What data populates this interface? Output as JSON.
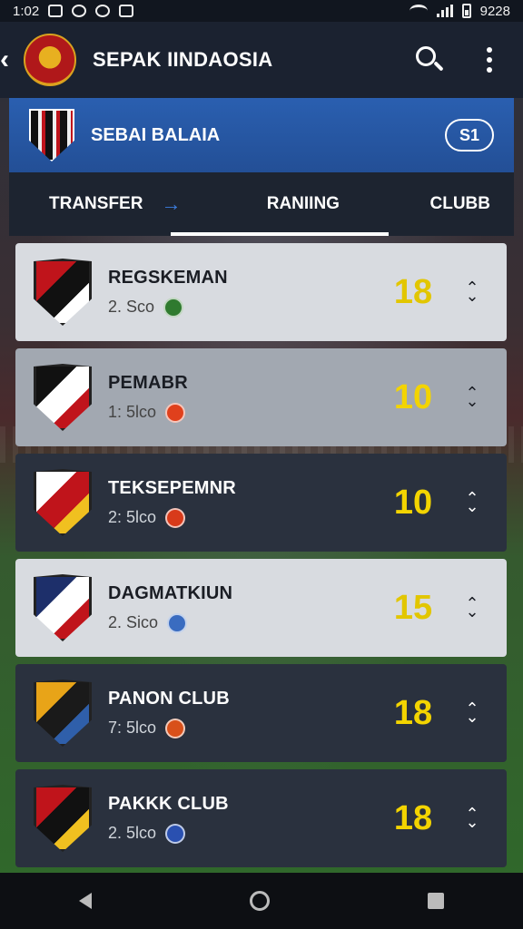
{
  "status": {
    "time": "1:02",
    "clock_right": "9228"
  },
  "app": {
    "title": "SEPAK IINDAOSIA"
  },
  "club": {
    "name": "SEBAI BALAIA",
    "badge": "S1"
  },
  "tabs": [
    {
      "label": "TRANSFER",
      "arrow": "→"
    },
    {
      "label": "RANIING"
    },
    {
      "label": "CLUBB"
    }
  ],
  "rows": [
    {
      "name": "REGSKEMAN",
      "sub": "2. Sco",
      "score": "18",
      "style": "light",
      "logo_colors": [
        "#c0141b",
        "#111111",
        "#ffffff"
      ],
      "mini_color": "#2f7a2f"
    },
    {
      "name": "PEMABR",
      "sub": "1: 5lco",
      "score": "10",
      "style": "mid",
      "logo_colors": [
        "#111111",
        "#ffffff",
        "#c0141b"
      ],
      "mini_color": "#e0401c"
    },
    {
      "name": "TEKSEPEMNR",
      "sub": "2: 5lco",
      "score": "10",
      "style": "dark",
      "logo_colors": [
        "#ffffff",
        "#c0141b",
        "#f0c020"
      ],
      "mini_color": "#d83a1a"
    },
    {
      "name": "DAGMATKIUN",
      "sub": "2. Sico",
      "score": "15",
      "style": "light",
      "logo_colors": [
        "#1d2f6a",
        "#ffffff",
        "#c0141b"
      ],
      "mini_color": "#3a6cc0"
    },
    {
      "name": "PANON CLUB",
      "sub": "7: 5lco",
      "score": "18",
      "style": "dark",
      "logo_colors": [
        "#e8a418",
        "#1a1a1a",
        "#2f5faa"
      ],
      "mini_color": "#d8501a"
    },
    {
      "name": "PAKKK CLUB",
      "sub": "2. 5lco",
      "score": "18",
      "style": "dark",
      "logo_colors": [
        "#c0141b",
        "#111111",
        "#f0c020"
      ],
      "mini_color": "#2a50b0"
    }
  ],
  "icons": {
    "back": "chevron-left-icon",
    "search": "search-icon",
    "menu": "more-vertical-icon",
    "chevron": "expand-icon"
  }
}
